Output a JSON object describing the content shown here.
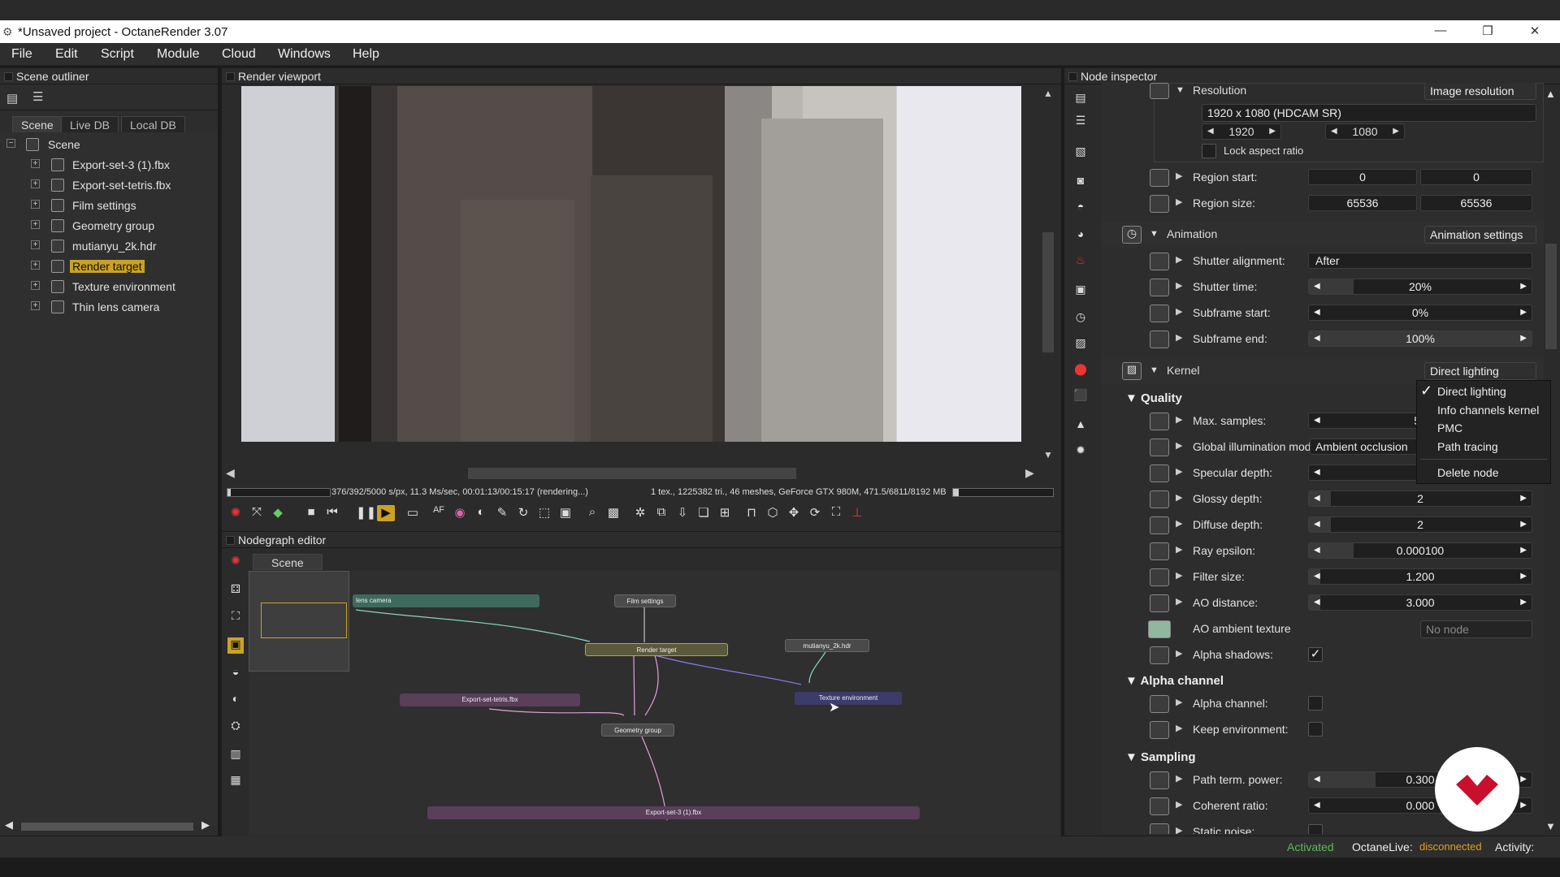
{
  "window": {
    "title": "*Unsaved project - OctaneRender 3.07",
    "minimize": "—",
    "restore": "❐",
    "close": "✕"
  },
  "menu": [
    "File",
    "Edit",
    "Script",
    "Module",
    "Cloud",
    "Windows",
    "Help"
  ],
  "outliner": {
    "title": "Scene outliner",
    "tabs": [
      "Scene",
      "Live DB",
      "Local DB"
    ],
    "root": "Scene",
    "items": [
      "Export-set-3 (1).fbx",
      "Export-set-tetris.fbx",
      "Film settings",
      "Geometry group",
      "mutianyu_2k.hdr",
      "Render target",
      "Texture environment",
      "Thin lens camera"
    ],
    "selected": "Render target"
  },
  "viewport": {
    "title": "Render viewport",
    "status_left": "376/392/5000 s/px, 11.3 Ms/sec, 00:01:13/00:15:17 (rendering...)",
    "status_right": "1 tex., 1225382 tri., 46 meshes, GeForce GTX 980M, 471.5/6811/8192 MB"
  },
  "nodegraph": {
    "title": "Nodegraph editor",
    "tab": "Scene",
    "nodes": {
      "camera": "lens camera",
      "film": "Film settings",
      "render": "Render target",
      "hdr": "mutianyu_2k.hdr",
      "tetris": "Export-set-tetris.fbx",
      "texenv": "Texture environment",
      "geom": "Geometry group",
      "export3": "Export-set-3 (1).fbx"
    }
  },
  "inspector": {
    "title": "Node inspector",
    "resolution": {
      "label": "Resolution",
      "mode": "Image resolution",
      "preset": "1920 x 1080 (HDCAM SR)",
      "width": "1920",
      "height": "1080",
      "lock": "Lock aspect ratio"
    },
    "region_start": {
      "label": "Region start:",
      "x": "0",
      "y": "0"
    },
    "region_size": {
      "label": "Region size:",
      "x": "65536",
      "y": "65536"
    },
    "animation": {
      "label": "Animation",
      "mode": "Animation settings",
      "shutter_alignment": {
        "label": "Shutter alignment:",
        "value": "After"
      },
      "shutter_time": {
        "label": "Shutter time:",
        "value": "20%",
        "fraction": 0.2
      },
      "subframe_start": {
        "label": "Subframe start:",
        "value": "0%",
        "fraction": 0
      },
      "subframe_end": {
        "label": "Subframe end:",
        "value": "100%",
        "fraction": 1
      }
    },
    "kernel": {
      "label": "Kernel",
      "mode": "Direct lighting"
    },
    "quality": {
      "label": "Quality",
      "max_samples": {
        "label": "Max. samples:",
        "value": "50"
      },
      "gi_mode": {
        "label": "Global illumination mode:",
        "value": "Ambient occlusion"
      },
      "specular_depth": {
        "label": "Specular depth:",
        "value": ""
      },
      "glossy_depth": {
        "label": "Glossy depth:",
        "value": "2",
        "fraction": 0.1
      },
      "diffuse_depth": {
        "label": "Diffuse depth:",
        "value": "2",
        "fraction": 0.1
      },
      "ray_epsilon": {
        "label": "Ray epsilon:",
        "value": "0.000100",
        "fraction": 0.2
      },
      "filter_size": {
        "label": "Filter size:",
        "value": "1.200",
        "fraction": 0.05
      },
      "ao_distance": {
        "label": "AO distance:",
        "value": "3.000",
        "fraction": 0.05
      },
      "ao_texture": {
        "label": "AO ambient texture",
        "value": "No node"
      },
      "alpha_shadows": {
        "label": "Alpha shadows:",
        "checked": "✓"
      }
    },
    "alpha": {
      "label": "Alpha channel",
      "alpha_channel": {
        "label": "Alpha channel:"
      },
      "keep_env": {
        "label": "Keep environment:"
      }
    },
    "sampling": {
      "label": "Sampling",
      "path_term": {
        "label": "Path term. power:",
        "value": "0.300",
        "fraction": 0.3
      },
      "coherent": {
        "label": "Coherent ratio:",
        "value": "0.000",
        "fraction": 0
      },
      "static_noise": {
        "label": "Static noise:"
      }
    },
    "context_menu": {
      "check": "✓",
      "items": [
        "Direct lighting",
        "Info channels kernel",
        "PMC",
        "Path tracing",
        "Delete node"
      ]
    }
  },
  "statusbar": {
    "activated": "Activated",
    "octanelive_label": "OctaneLive:",
    "octanelive_state": "disconnected",
    "activity": "Activity:"
  },
  "colors": {
    "accent": "#c9a227",
    "activated": "#5cb85c",
    "disconnected": "#e0a020",
    "brand": "#c8102e"
  }
}
